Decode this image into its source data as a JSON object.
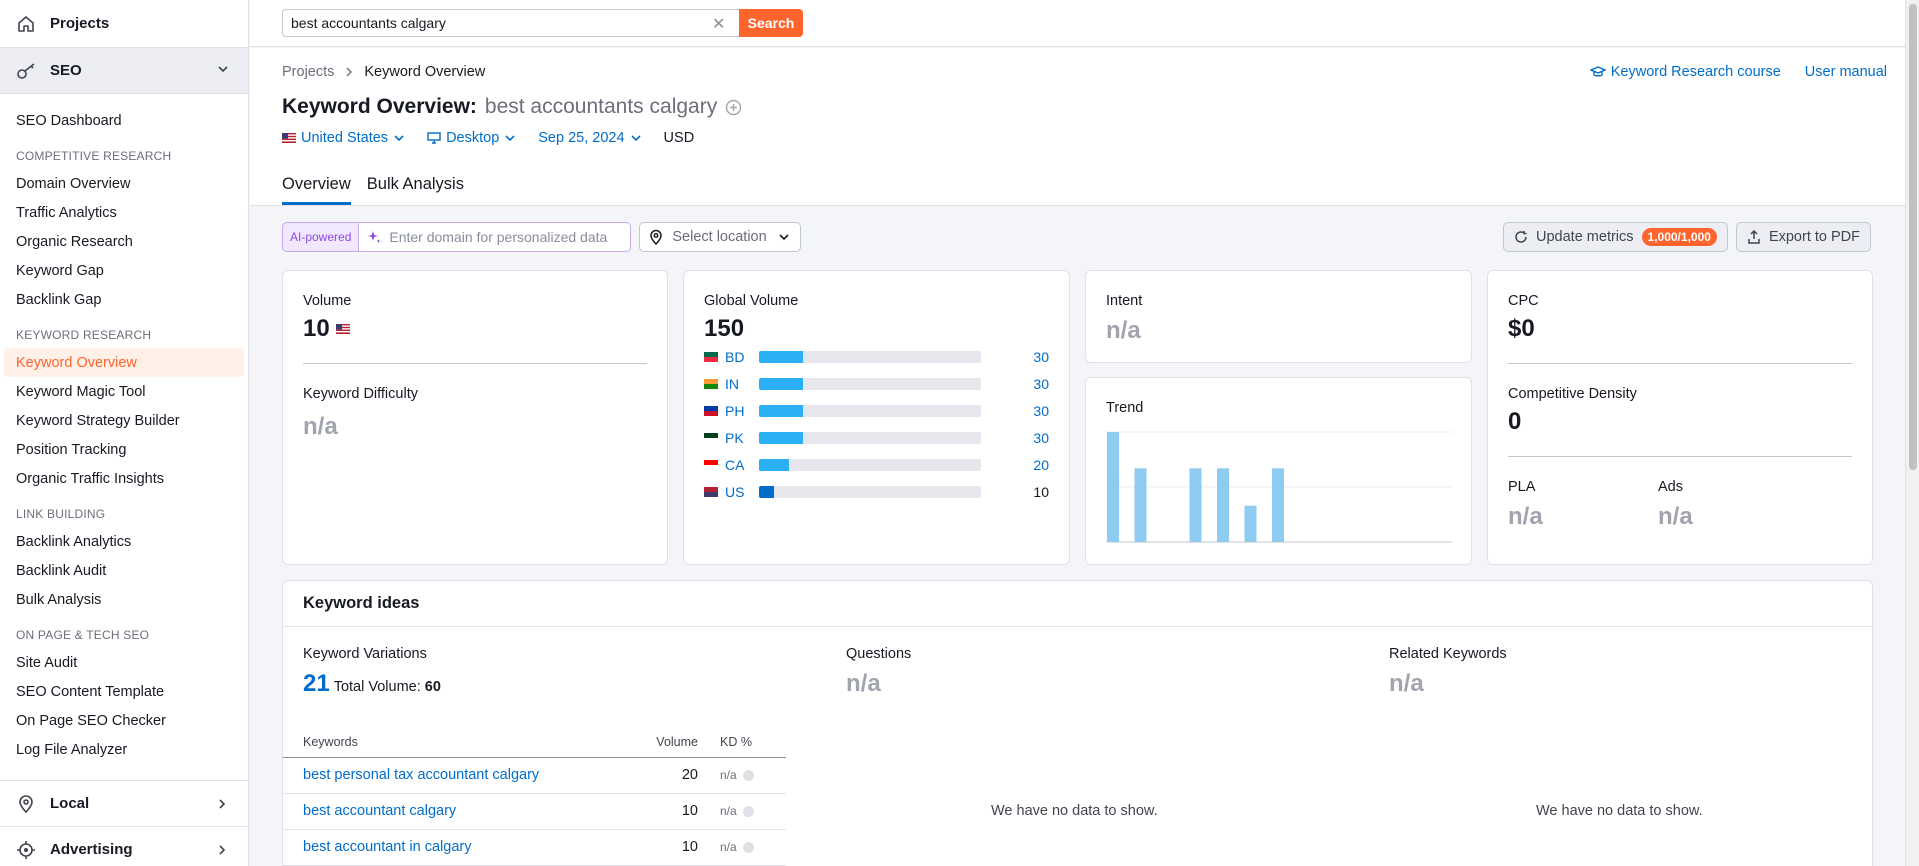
{
  "sidebar": {
    "projects": "Projects",
    "seo": "SEO",
    "dashboard": "SEO Dashboard",
    "sections": [
      {
        "head": "COMPETITIVE RESEARCH",
        "items": [
          "Domain Overview",
          "Traffic Analytics",
          "Organic Research",
          "Keyword Gap",
          "Backlink Gap"
        ]
      },
      {
        "head": "KEYWORD RESEARCH",
        "items": [
          "Keyword Overview",
          "Keyword Magic Tool",
          "Keyword Strategy Builder",
          "Position Tracking",
          "Organic Traffic Insights"
        ]
      },
      {
        "head": "LINK BUILDING",
        "items": [
          "Backlink Analytics",
          "Backlink Audit",
          "Bulk Analysis"
        ]
      },
      {
        "head": "ON PAGE & TECH SEO",
        "items": [
          "Site Audit",
          "SEO Content Template",
          "On Page SEO Checker",
          "Log File Analyzer"
        ]
      }
    ],
    "local": "Local",
    "advertising": "Advertising"
  },
  "search": {
    "value": "best accountants calgary",
    "button": "Search"
  },
  "header": {
    "crumb_root": "Projects",
    "crumb_current": "Keyword Overview",
    "course_link": "Keyword Research course",
    "manual_link": "User manual",
    "title_prefix": "Keyword Overview:",
    "title_keyword": "best accountants calgary",
    "country": "United States",
    "device": "Desktop",
    "date": "Sep 25, 2024",
    "currency": "USD",
    "tabs": [
      "Overview",
      "Bulk Analysis"
    ]
  },
  "toolbar": {
    "ai_label": "AI-powered",
    "ai_placeholder": "Enter domain for personalized data",
    "location_placeholder": "Select location",
    "update_label": "Update metrics",
    "update_badge": "1,000/1,000",
    "export_label": "Export to PDF"
  },
  "volume_card": {
    "label": "Volume",
    "value": "10",
    "kd_label": "Keyword Difficulty",
    "kd_value": "n/a"
  },
  "global_card": {
    "label": "Global Volume",
    "value": "150",
    "rows": [
      {
        "code": "BD",
        "value": 30,
        "label": "30"
      },
      {
        "code": "IN",
        "value": 30,
        "label": "30"
      },
      {
        "code": "PH",
        "value": 30,
        "label": "30"
      },
      {
        "code": "PK",
        "value": 30,
        "label": "30"
      },
      {
        "code": "CA",
        "value": 20,
        "label": "20"
      },
      {
        "code": "US",
        "value": 10,
        "label": "10"
      }
    ],
    "bar_max": 150
  },
  "intent_card": {
    "label": "Intent",
    "value": "n/a"
  },
  "trend_card": {
    "label": "Trend",
    "bars": [
      1.0,
      0.67,
      0,
      0.67,
      0.67,
      0.33,
      0.67,
      0,
      0,
      0,
      0,
      0
    ]
  },
  "cpc_card": {
    "cpc_label": "CPC",
    "cpc_value": "$0",
    "cd_label": "Competitive Density",
    "cd_value": "0",
    "pla_label": "PLA",
    "pla_value": "n/a",
    "ads_label": "Ads",
    "ads_value": "n/a"
  },
  "ideas": {
    "title": "Keyword ideas",
    "variations_label": "Keyword Variations",
    "variations_count": "21",
    "total_volume_label": "Total Volume:",
    "total_volume": "60",
    "questions_label": "Questions",
    "questions_value": "n/a",
    "related_label": "Related Keywords",
    "related_value": "n/a",
    "no_data": "We have no data to show.",
    "columns": [
      "Keywords",
      "Volume",
      "KD %"
    ],
    "rows": [
      {
        "keyword": "best personal tax accountant calgary",
        "volume": "20",
        "kd": "n/a"
      },
      {
        "keyword": "best accountant calgary",
        "volume": "10",
        "kd": "n/a"
      },
      {
        "keyword": "best accountant in calgary",
        "volume": "10",
        "kd": "n/a"
      }
    ]
  },
  "colors": {
    "accent": "#ff642d",
    "link": "#006dca",
    "bar": "#2bb0f5",
    "trend": "#8fcaf0"
  }
}
